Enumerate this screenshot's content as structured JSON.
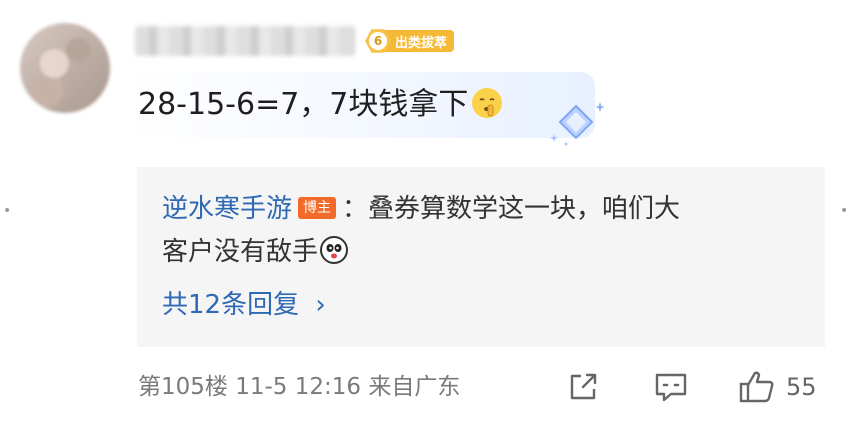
{
  "comment": {
    "username": "",
    "badge": {
      "level": "6",
      "label": "出类拔萃"
    },
    "text": "28-15-6=7，7块钱拿下",
    "emoji_icon": "shushing-face-emoji"
  },
  "reply": {
    "author": "逆水寒手游",
    "tag": "博主",
    "colon": "：",
    "text_line1": "叠券算数学这一块，咱们大",
    "text_line2": "客户没有敌手",
    "emoji_icon": "panda-face-emoji",
    "more_label": "共12条回复",
    "more_chevron": "›"
  },
  "footer": {
    "meta": "第105楼 11-5 12:16 来自广东",
    "share_icon": "share-icon",
    "comment_icon": "comment-icon",
    "like_icon": "thumbs-up-icon",
    "likes": "55"
  },
  "colors": {
    "link_blue": "#2f68b3",
    "badge_gold": "#f5b935",
    "blogger_tag": "#f26b2a",
    "reply_bg": "#f5f5f5",
    "meta_gray": "#7a7a7a"
  }
}
